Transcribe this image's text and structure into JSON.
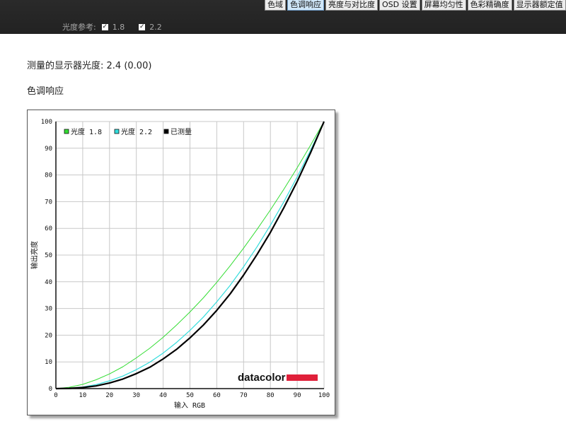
{
  "tabs": [
    {
      "label": "色域",
      "active": false
    },
    {
      "label": "色调响应",
      "active": true
    },
    {
      "label": "亮度与对比度",
      "active": false
    },
    {
      "label": "OSD 设置",
      "active": false
    },
    {
      "label": "屏幕均匀性",
      "active": false
    },
    {
      "label": "色彩精确度",
      "active": false
    },
    {
      "label": "显示器额定值",
      "active": false
    }
  ],
  "gamma_ref": {
    "label": "光度参考:",
    "options": [
      {
        "value": "1.8",
        "checked": true
      },
      {
        "value": "2.2",
        "checked": true
      }
    ]
  },
  "measured_text": "测量的显示器光度:  2.4 (0.00)",
  "section_title": "色调响应",
  "logo_text": "datacolor",
  "colors": {
    "series_1_8": "#33dd33",
    "series_2_2": "#33dddd",
    "series_measured": "#000000",
    "logo_bar": "#e0203a"
  },
  "chart_data": {
    "type": "line",
    "xlabel": "输入 RGB",
    "ylabel": "输出亮度",
    "xlim": [
      0,
      100
    ],
    "ylim": [
      0,
      100
    ],
    "xticks": [
      0,
      10,
      20,
      30,
      40,
      50,
      60,
      70,
      80,
      90,
      100
    ],
    "yticks": [
      0,
      10,
      20,
      30,
      40,
      50,
      60,
      70,
      80,
      90,
      100
    ],
    "grid": true,
    "legend_position": "top-left",
    "x": [
      0,
      5,
      10,
      15,
      20,
      25,
      30,
      35,
      40,
      45,
      50,
      55,
      60,
      65,
      70,
      75,
      80,
      85,
      90,
      95,
      100
    ],
    "series": [
      {
        "name": "光度 1.8",
        "color": "#33dd33",
        "width": 1,
        "values": [
          0,
          0.5,
          1.6,
          3.3,
          5.5,
          8.2,
          11.5,
          15.1,
          19.2,
          23.8,
          28.7,
          34.0,
          39.8,
          46.0,
          52.6,
          59.6,
          66.9,
          74.6,
          82.7,
          91.2,
          100
        ]
      },
      {
        "name": "光度 2.2",
        "color": "#33dddd",
        "width": 1.2,
        "values": [
          0,
          0.1,
          0.6,
          1.5,
          2.9,
          4.7,
          7.1,
          9.9,
          13.3,
          17.3,
          21.8,
          26.8,
          32.5,
          38.7,
          45.6,
          53.1,
          61.2,
          69.9,
          79.3,
          89.3,
          100
        ]
      },
      {
        "name": "已测量",
        "color": "#000000",
        "width": 2.2,
        "values": [
          0,
          0.1,
          0.4,
          1.0,
          2.1,
          3.6,
          5.6,
          8.0,
          11.1,
          14.7,
          19.0,
          23.8,
          29.3,
          35.5,
          42.5,
          50.2,
          58.5,
          67.7,
          77.6,
          88.4,
          100
        ]
      }
    ]
  }
}
